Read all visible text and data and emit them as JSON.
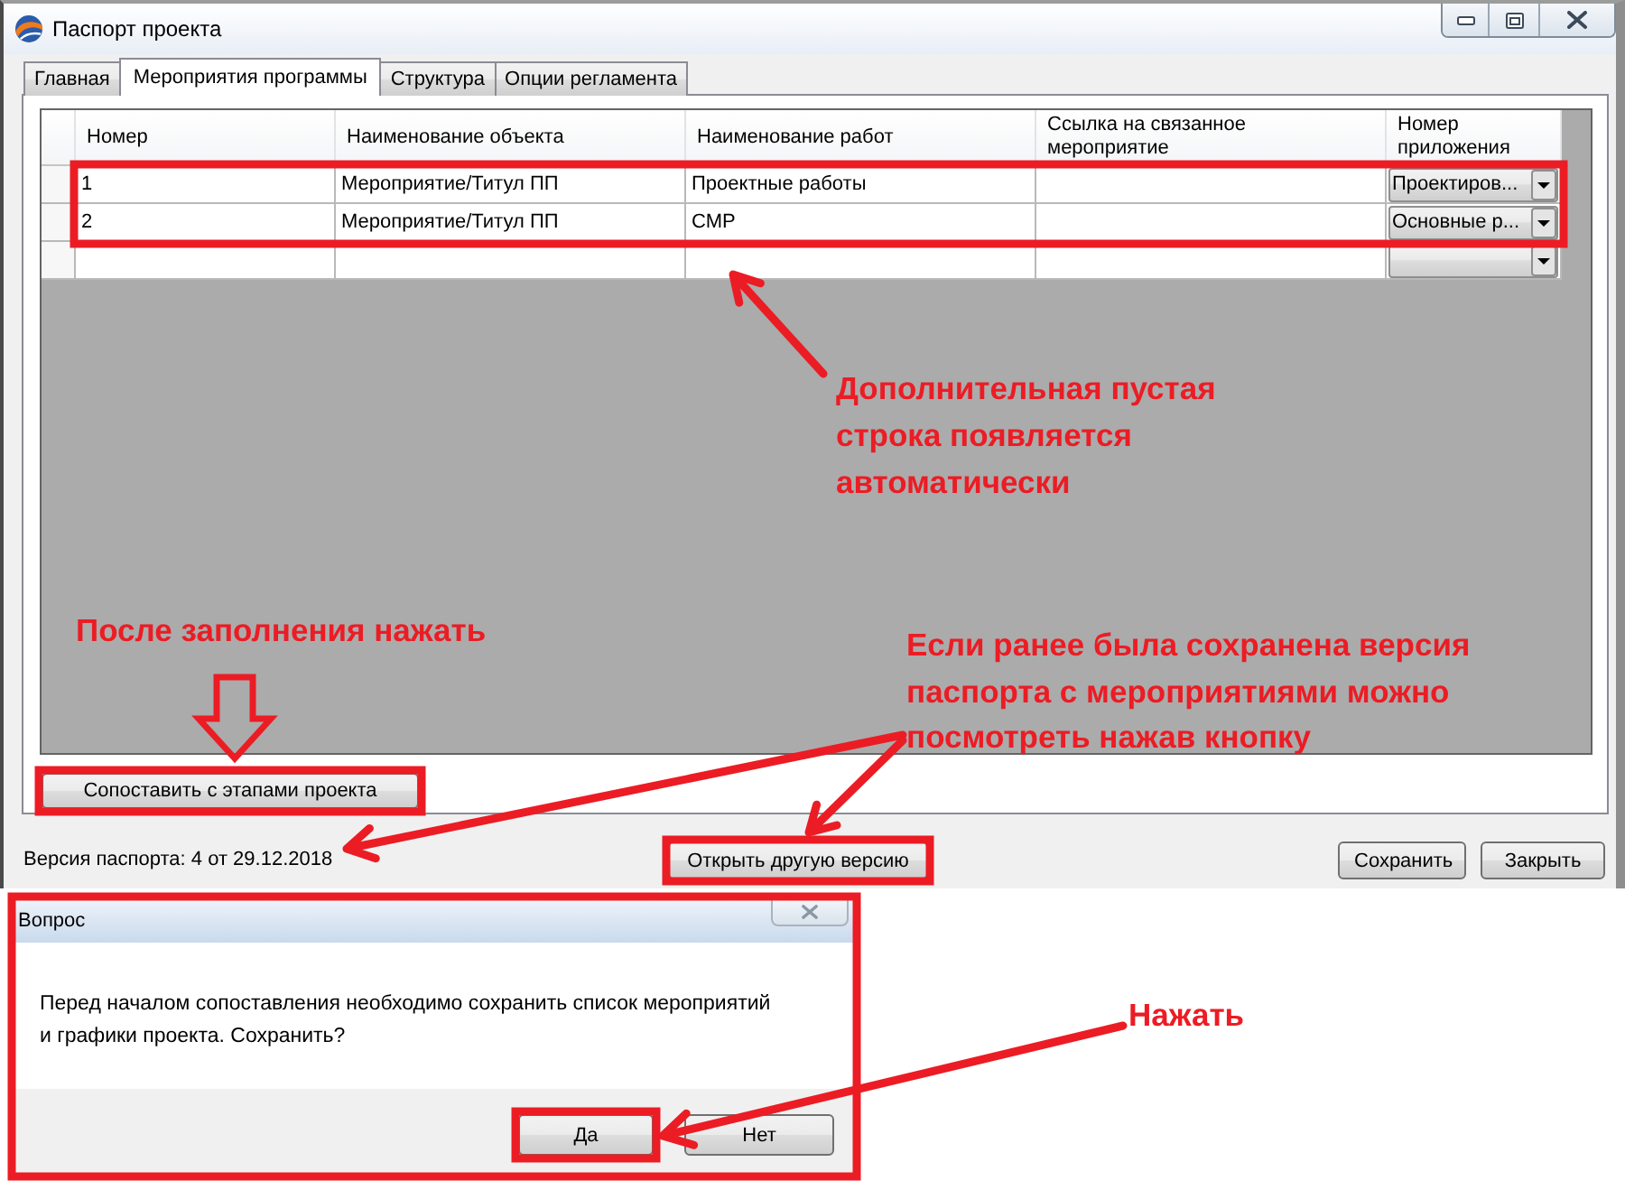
{
  "window": {
    "title": "Паспорт проекта"
  },
  "tabs": [
    {
      "label": "Главная",
      "selected": false
    },
    {
      "label": "Мероприятия программы",
      "selected": true
    },
    {
      "label": "Структура",
      "selected": false
    },
    {
      "label": "Опции регламента",
      "selected": false
    }
  ],
  "table": {
    "columns": [
      "Номер",
      "Наименование объекта",
      "Наименование работ",
      "Ссылка на связанное мероприятие",
      "Номер приложения"
    ],
    "rows": [
      {
        "number": "1",
        "object": "Мероприятие/Титул ПП",
        "work": "Проектные работы",
        "appendix": "Проектиров...",
        "highlighted": true
      },
      {
        "number": "2",
        "object": "Мероприятие/Титул ПП",
        "work": "СМР",
        "appendix": "Основные р...",
        "highlighted": true
      },
      {
        "highlighted": false
      }
    ]
  },
  "compare_button": {
    "label": "Сопоставить с этапами проекта",
    "highlighted": true
  },
  "footer": {
    "version": "Версия паспорта: 4 от 29.12.2018",
    "buttons": [
      {
        "label": "Открыть другую версию",
        "highlighted": true
      },
      {
        "label": "Сохранить",
        "highlighted": false
      },
      {
        "label": "Закрыть",
        "highlighted": false
      }
    ]
  },
  "dialog": {
    "title": "Вопрос",
    "message_lines": [
      "Перед началом сопоставления необходимо сохранить список мероприятий",
      "и графики проекта. Сохранить?"
    ],
    "buttons": [
      {
        "label": "Да",
        "highlighted": true
      },
      {
        "label": "Нет",
        "highlighted": false
      }
    ],
    "highlighted": true
  },
  "annotations": [
    {
      "lines": [
        "Дополнительная пустая",
        "строка появляется",
        "автоматически"
      ]
    },
    {
      "lines": [
        "После заполнения нажать"
      ]
    },
    {
      "lines": [
        "Если ранее была сохранена версия",
        "паспорта с мероприятиями можно",
        "посмотреть нажав кнопку"
      ]
    },
    {
      "lines": [
        "Нажать"
      ]
    }
  ]
}
